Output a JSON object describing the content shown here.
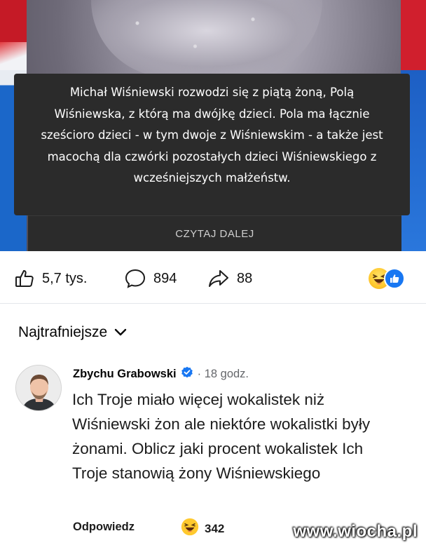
{
  "post": {
    "caption": "Michał Wiśniewski rozwodzi się z piątą żoną, Polą Wiśniewska, z którą ma dwójkę dzieci. Pola ma łącznie sześcioro dzieci - w tym dwoje z Wiśniewskim - a także jest macochą dla czwórki pozostałych dzieci Wiśniewskiego z wcześniejszych małżeństw.",
    "read_more_label": "CZYTAJ DALEJ"
  },
  "reactions_bar": {
    "like_count": "5,7 tys.",
    "comment_count": "894",
    "share_count": "88",
    "icons": [
      "haha-emoji-icon",
      "like-badge-icon"
    ]
  },
  "comments_section": {
    "sort_label": "Najtrafniejsze",
    "comment": {
      "author": "Zbychu Grabowski",
      "timestamp": "· 18 godz.",
      "text": "Ich Troje miało więcej wokalistek niż Wiśniewski żon ale niektóre wokalistki były żonami. Oblicz jaki procent wokalistek Ich Troje stanowią żony Wiśniewskiego",
      "reply_label": "Odpowiedz",
      "reaction_count": "342"
    }
  },
  "watermark": "www.wiocha.pl",
  "colors": {
    "accent": "#1877f2",
    "caption_bg": "#2b2b2b",
    "muted_text": "#65676b"
  }
}
